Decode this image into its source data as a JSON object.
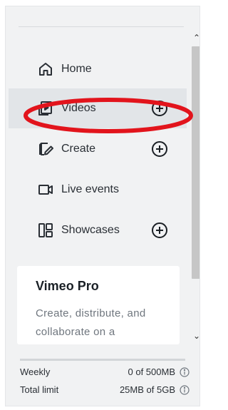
{
  "sidebar": {
    "items": [
      {
        "label": "Home",
        "icon": "home-icon"
      },
      {
        "label": "Videos",
        "icon": "videos-icon",
        "active": true,
        "has_add": true
      },
      {
        "label": "Create",
        "icon": "create-icon",
        "has_add": true
      },
      {
        "label": "Live events",
        "icon": "live-events-icon"
      },
      {
        "label": "Showcases",
        "icon": "showcases-icon",
        "has_add": true
      }
    ]
  },
  "promo": {
    "title": "Vimeo Pro",
    "description": "Create, distribute, and collaborate on a"
  },
  "usage": {
    "weekly_label": "Weekly",
    "weekly_value": "0 of 500MB",
    "total_label": "Total limit",
    "total_value": "25MB of 5GB"
  },
  "colors": {
    "highlight_ring": "#e2141c",
    "panel_bg": "#f1f2f3",
    "active_bg": "#e2e5e8",
    "text": "#2a2f35"
  }
}
